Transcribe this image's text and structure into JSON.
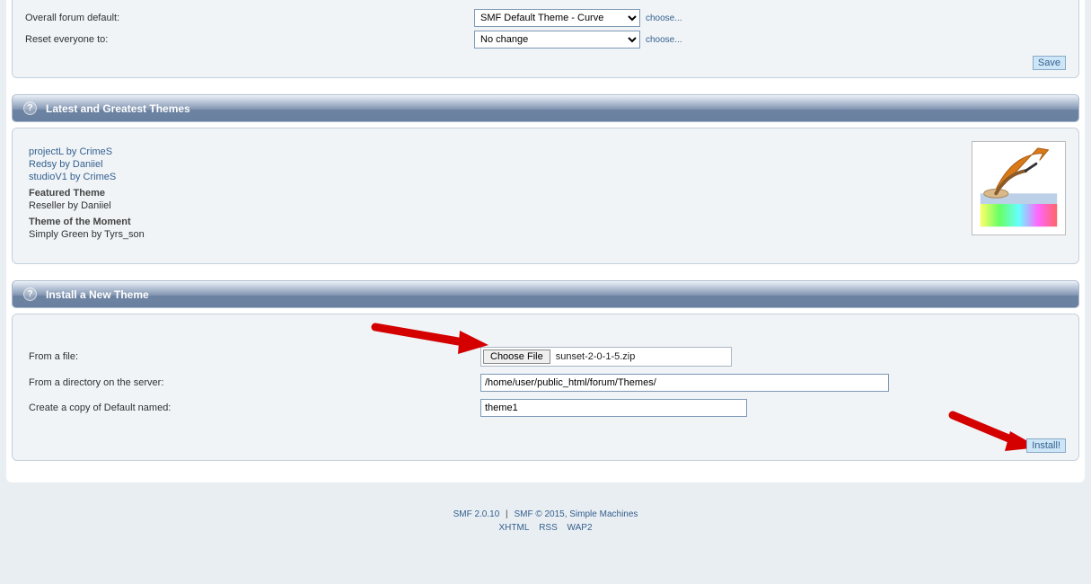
{
  "top": {
    "default_label": "Overall forum default:",
    "default_select": "SMF Default Theme - Curve",
    "reset_label": "Reset everyone to:",
    "reset_select": "No change",
    "choose": "choose...",
    "save": "Save"
  },
  "latest": {
    "title": "Latest and Greatest Themes",
    "links": [
      "projectL by CrimeS",
      "Redsy by Daniiel",
      "studioV1 by CrimeS"
    ],
    "featured_heading": "Featured Theme",
    "featured_item": "Reseller by Daniiel",
    "moment_heading": "Theme of the Moment",
    "moment_item": "Simply Green by Tyrs_son"
  },
  "install": {
    "title": "Install a New Theme",
    "from_file": "From a file:",
    "choose_file_btn": "Choose File",
    "chosen_file": "sunset-2-0-1-5.zip",
    "from_dir": "From a directory on the server:",
    "dir_value": "/home/user/public_html/forum/Themes/",
    "copy_label": "Create a copy of Default named:",
    "copy_value": "theme1",
    "install_btn": "Install!"
  },
  "footer": {
    "line1_a": "SMF 2.0.10",
    "line1_b": "SMF © 2015, Simple Machines",
    "xhtml": "XHTML",
    "rss": "RSS",
    "wap2": "WAP2"
  }
}
